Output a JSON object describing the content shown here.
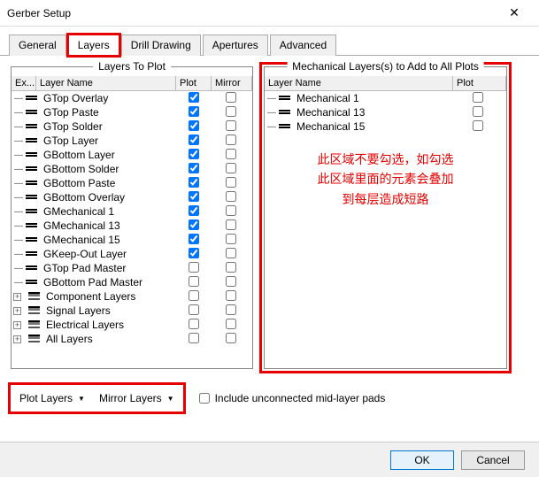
{
  "window": {
    "title": "Gerber Setup"
  },
  "tabs": {
    "general": "General",
    "layers": "Layers",
    "drill": "Drill Drawing",
    "apertures": "Apertures",
    "advanced": "Advanced",
    "active": "layers"
  },
  "leftPanel": {
    "title": "Layers To Plot",
    "cols": {
      "ex": "Ex...",
      "name": "Layer Name",
      "plot": "Plot",
      "mirror": "Mirror"
    },
    "rows": [
      {
        "name": "GTop Overlay",
        "plot": true,
        "mirror": false
      },
      {
        "name": "GTop Paste",
        "plot": true,
        "mirror": false
      },
      {
        "name": "GTop Solder",
        "plot": true,
        "mirror": false
      },
      {
        "name": "GTop Layer",
        "plot": true,
        "mirror": false
      },
      {
        "name": "GBottom Layer",
        "plot": true,
        "mirror": false
      },
      {
        "name": "GBottom Solder",
        "plot": true,
        "mirror": false
      },
      {
        "name": "GBottom Paste",
        "plot": true,
        "mirror": false
      },
      {
        "name": "GBottom Overlay",
        "plot": true,
        "mirror": false
      },
      {
        "name": "GMechanical 1",
        "plot": true,
        "mirror": false
      },
      {
        "name": "GMechanical 13",
        "plot": true,
        "mirror": false
      },
      {
        "name": "GMechanical 15",
        "plot": true,
        "mirror": false
      },
      {
        "name": "GKeep-Out Layer",
        "plot": true,
        "mirror": false
      },
      {
        "name": "GTop Pad Master",
        "plot": false,
        "mirror": false
      },
      {
        "name": "GBottom Pad Master",
        "plot": false,
        "mirror": false
      }
    ],
    "groups": [
      {
        "name": "Component Layers"
      },
      {
        "name": "Signal Layers"
      },
      {
        "name": "Electrical Layers"
      },
      {
        "name": "All Layers"
      }
    ]
  },
  "rightPanel": {
    "title": "Mechanical Layers(s) to Add to All Plots",
    "cols": {
      "name": "Layer Name",
      "plot": "Plot"
    },
    "rows": [
      {
        "name": "Mechanical 1",
        "plot": false
      },
      {
        "name": "Mechanical 13",
        "plot": false
      },
      {
        "name": "Mechanical 15",
        "plot": false
      }
    ],
    "annotation": {
      "l1": "此区域不要勾选，如勾选",
      "l2": "此区域里面的元素会叠加",
      "l3": "到每层造成短路"
    }
  },
  "dropdowns": {
    "plotLayers": "Plot Layers",
    "mirrorLayers": "Mirror Layers"
  },
  "includePads": {
    "label": "Include unconnected mid-layer pads",
    "checked": false
  },
  "footer": {
    "ok": "OK",
    "cancel": "Cancel"
  }
}
